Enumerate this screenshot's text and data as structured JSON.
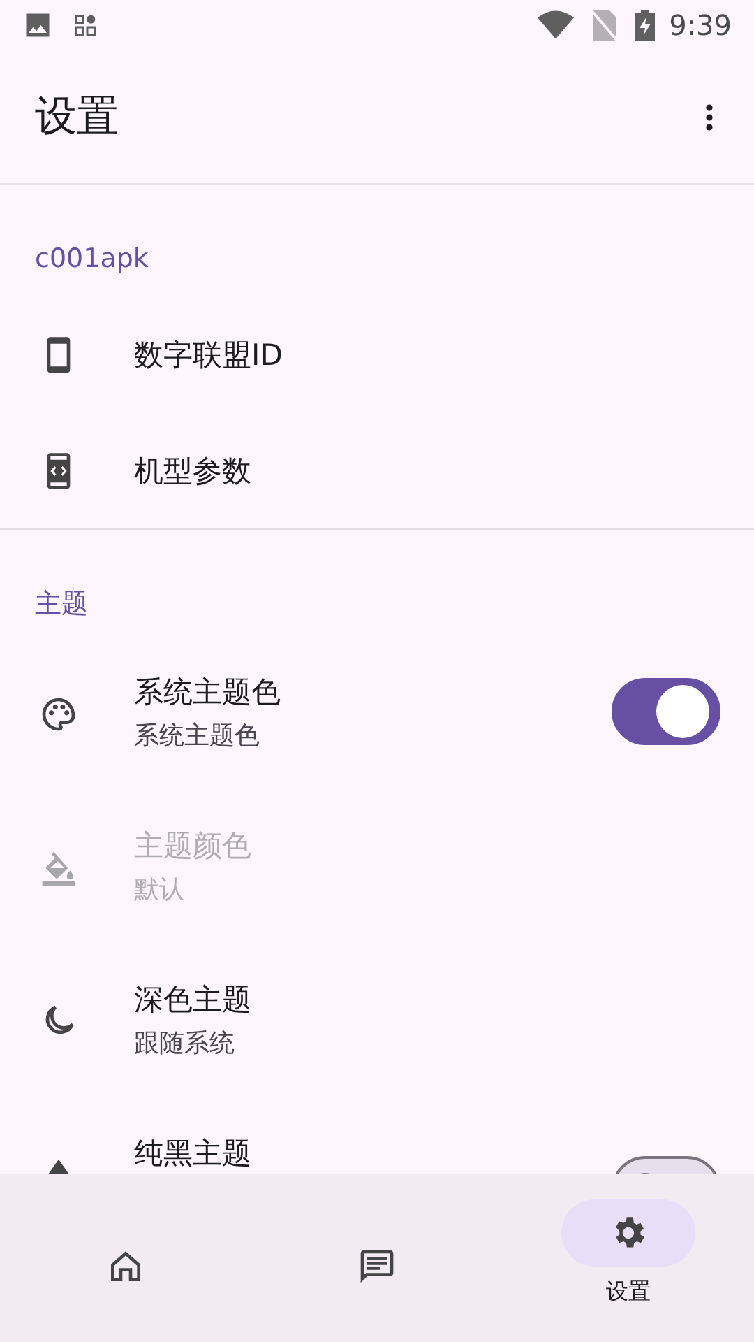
{
  "status_bar": {
    "time": "9:39"
  },
  "app_bar": {
    "title": "设置"
  },
  "sections": [
    {
      "header": "c001apk",
      "items": [
        {
          "kind": "link",
          "title": "数字联盟ID",
          "disabled": false
        },
        {
          "kind": "link",
          "title": "机型参数",
          "disabled": false
        }
      ]
    },
    {
      "header": "主题",
      "items": [
        {
          "kind": "switch",
          "title": "系统主题色",
          "subtitle": "系统主题色",
          "disabled": false,
          "on": true
        },
        {
          "kind": "link",
          "title": "主题颜色",
          "subtitle": "默认",
          "disabled": true
        },
        {
          "kind": "link",
          "title": "深色主题",
          "subtitle": "跟随系统",
          "disabled": false
        },
        {
          "kind": "switch",
          "title": "纯黑主题",
          "disabled": false,
          "on": false
        }
      ]
    }
  ],
  "bottom_nav": [
    {
      "selected": false
    },
    {
      "selected": false
    },
    {
      "label": "设置",
      "selected": true
    }
  ]
}
